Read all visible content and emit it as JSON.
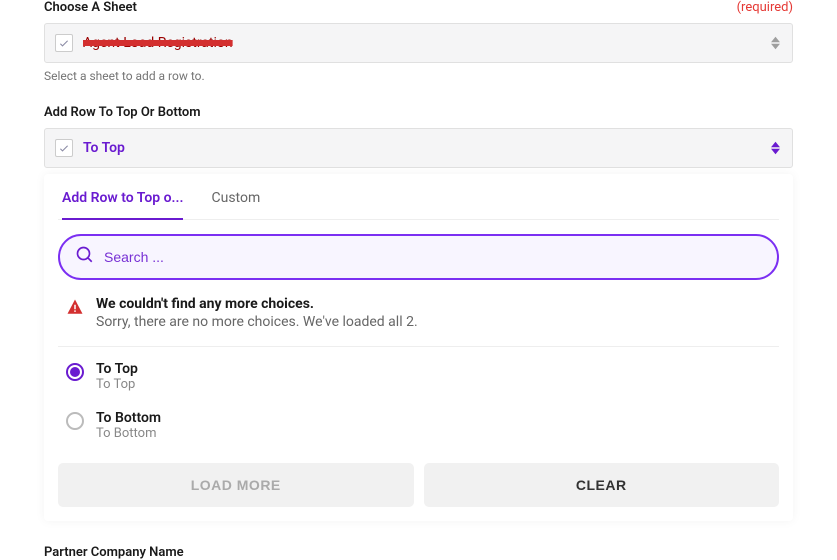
{
  "sheet_field": {
    "label": "Choose A Sheet",
    "required_text": "(required)",
    "value_redacted": "Agent Load Registration",
    "helper": "Select a sheet to add a row to."
  },
  "position_field": {
    "label": "Add Row To Top Or Bottom",
    "value": "To Top"
  },
  "dropdown": {
    "tabs": {
      "active": "Add Row to Top o...",
      "custom": "Custom"
    },
    "search_placeholder": "Search ...",
    "warning": {
      "title": "We couldn't find any more choices.",
      "subtitle": "Sorry, there are no more choices. We've loaded all 2."
    },
    "options": [
      {
        "label": "To Top",
        "sub": "To Top",
        "selected": true
      },
      {
        "label": "To Bottom",
        "sub": "To Bottom",
        "selected": false
      }
    ],
    "load_more": "LOAD MORE",
    "clear": "CLEAR"
  },
  "partner_field_label": "Partner Company Name"
}
